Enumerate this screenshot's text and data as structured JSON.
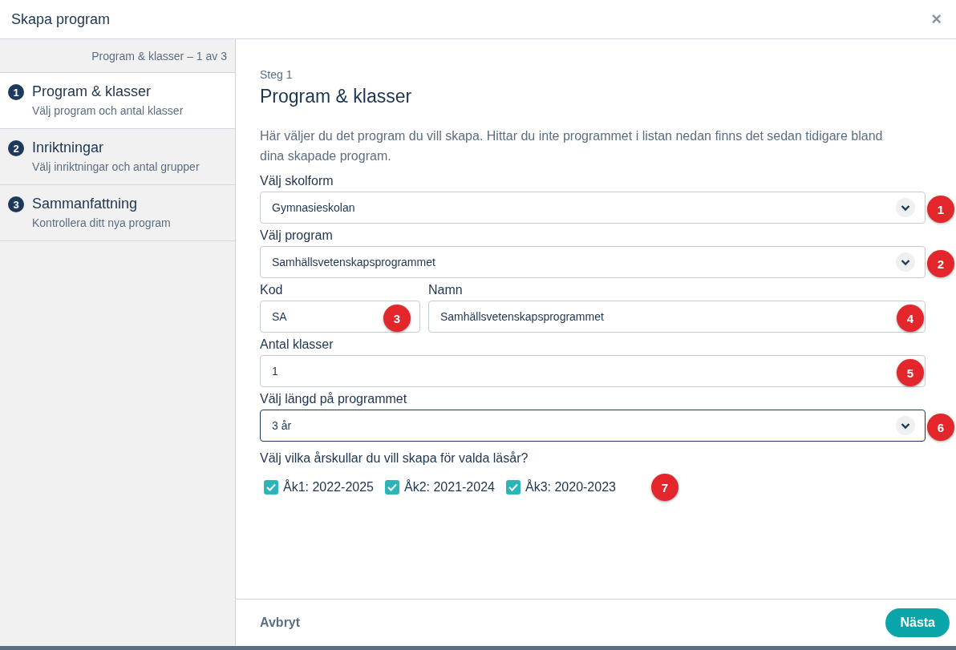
{
  "window": {
    "title": "Skapa program",
    "close": "×"
  },
  "sidebar": {
    "progress": "Program & klasser – 1 av 3",
    "steps": [
      {
        "number": "1",
        "title": "Program & klasser",
        "subtitle": "Välj program och antal klasser",
        "selected": true
      },
      {
        "number": "2",
        "title": "Inriktningar",
        "subtitle": "Välj inriktningar och antal grupper",
        "selected": false
      },
      {
        "number": "3",
        "title": "Sammanfattning",
        "subtitle": "Kontrollera ditt nya program",
        "selected": false
      }
    ]
  },
  "content": {
    "step_label": "Steg 1",
    "heading": "Program & klasser",
    "intro": "Här väljer du det program du vill skapa. Hittar du inte programmet i listan nedan finns det sedan tidigare bland dina skapade program.",
    "rows": [
      {
        "fields": [
          {
            "kind": "select",
            "label": "Välj skolform",
            "value": "Gymnasieskolan",
            "focused": false,
            "marker": "1"
          }
        ]
      },
      {
        "fields": [
          {
            "kind": "select",
            "label": "Välj program",
            "value": "Samhällsvetenskapsprogrammet",
            "focused": false,
            "marker": "2"
          }
        ]
      },
      {
        "fields": [
          {
            "kind": "input",
            "label": "Kod",
            "value": "SA",
            "focused": false,
            "marker": "3"
          },
          {
            "kind": "input",
            "label": "Namn",
            "value": "Samhällsvetenskapsprogrammet",
            "focused": false,
            "marker": "4"
          }
        ]
      },
      {
        "fields": [
          {
            "kind": "input",
            "label": "Antal klasser",
            "value": "1",
            "focused": false,
            "marker": "5"
          }
        ]
      },
      {
        "fields": [
          {
            "kind": "select",
            "label": "Välj längd på programmet",
            "value": "3 år",
            "focused": true,
            "marker": "6"
          }
        ]
      }
    ],
    "year_question": "Välj vilka årskullar du vill skapa för valda läsår?",
    "years": [
      {
        "label": "Åk1: 2022-2025",
        "checked": true
      },
      {
        "label": "Åk2: 2021-2024",
        "checked": true
      },
      {
        "label": "Åk3: 2020-2023",
        "checked": true
      }
    ],
    "years_marker": "7"
  },
  "footer": {
    "cancel": "Avbryt",
    "next": "Nästa"
  }
}
